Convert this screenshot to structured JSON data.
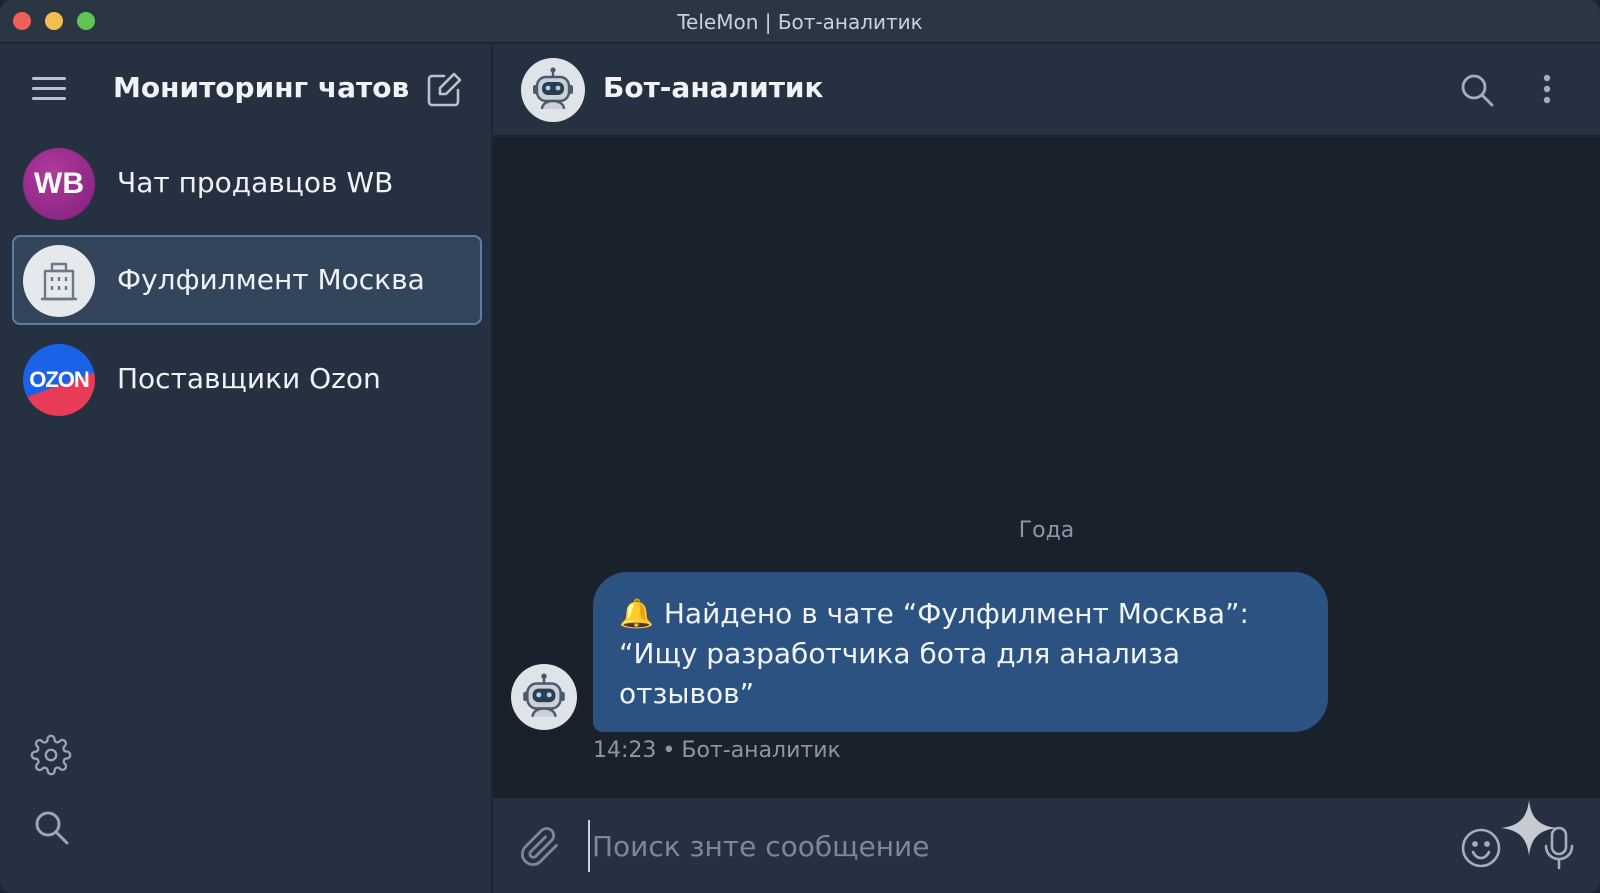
{
  "window": {
    "title": "TeleMon | Бот-аналитик"
  },
  "sidebar": {
    "title": "Мониторинг чатов",
    "chats": [
      {
        "name": "Чат продавцов WB",
        "avatar_text": "WB",
        "active": false
      },
      {
        "name": "Фулфилмент Москва",
        "avatar_icon": "building-icon",
        "active": true
      },
      {
        "name": "Поставщики Ozon",
        "avatar_text": "OZON",
        "active": false
      }
    ]
  },
  "chat": {
    "title": "Бот-аналитик",
    "date_separator": "Года",
    "message": {
      "emoji": "🔔",
      "text": "Найдено в чате “Фулфилмент Москва”: “Ищу разработчика бота для анализа отзывов”",
      "time": "14:23",
      "separator": "•",
      "sender": "Бот-аналитик"
    },
    "composer": {
      "placeholder": "Поиск знте сообщение"
    }
  },
  "colors": {
    "background": "#1f2a37",
    "sidebar": "#253140",
    "active_chat": "#33455b",
    "bubble": "#2c5281",
    "messages_bg": "#18212c"
  }
}
